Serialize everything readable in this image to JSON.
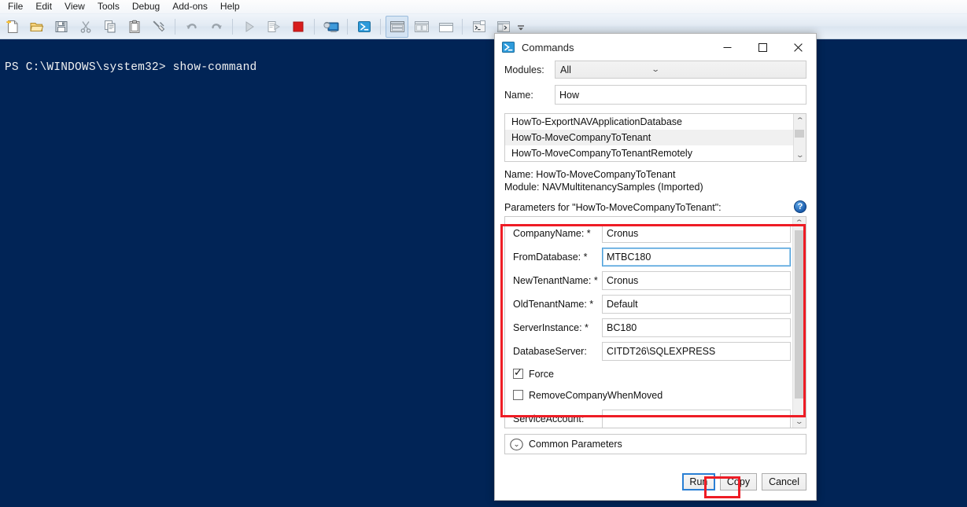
{
  "app": {
    "menu": [
      "File",
      "Edit",
      "View",
      "Tools",
      "Debug",
      "Add-ons",
      "Help"
    ],
    "toolbar_icons": [
      "new-script-icon",
      "open-folder-icon",
      "save-icon",
      "cut-icon",
      "copy-icon",
      "paste-icon",
      "clear-console-icon",
      "undo-icon",
      "redo-icon",
      "run-script-icon",
      "run-selection-icon",
      "stop-icon",
      "new-remote-tab-icon",
      "start-powershell-icon",
      "layout-horizontal-icon",
      "layout-vertical-icon",
      "layout-maximized-icon",
      "show-script-pane-icon",
      "show-console-pane-icon"
    ],
    "toolbar_overflow": "toolbar-overflow-icon"
  },
  "console": {
    "prompt_line": "PS C:\\WINDOWS\\system32> show-command",
    "background": "#012456",
    "foreground": "#f2f2f2"
  },
  "dialog": {
    "title": "Commands",
    "icon": "powershell-icon",
    "window_buttons": {
      "minimize": "—",
      "maximize": "☐",
      "close": "✕"
    },
    "modules": {
      "label": "Modules:",
      "value": "All"
    },
    "name": {
      "label": "Name:",
      "value": "How",
      "placeholder": ""
    },
    "command_list": [
      {
        "text": "HowTo-ExportNAVApplicationDatabase",
        "selected": false
      },
      {
        "text": "HowTo-MoveCompanyToTenant",
        "selected": true
      },
      {
        "text": "HowTo-MoveCompanyToTenantRemotely",
        "selected": false
      }
    ],
    "meta": {
      "name_line": "Name: HowTo-MoveCompanyToTenant",
      "module_line": "Module: NAVMultitenancySamples (Imported)"
    },
    "parameters_header": "Parameters for \"HowTo-MoveCompanyToTenant\":",
    "help_glyph": "?",
    "parameters": [
      {
        "label": "CompanyName: *",
        "value": "Cronus",
        "type": "text",
        "focused": false
      },
      {
        "label": "FromDatabase: *",
        "value": "MTBC180",
        "type": "text",
        "focused": true
      },
      {
        "label": "NewTenantName: *",
        "value": "Cronus",
        "type": "text",
        "focused": false
      },
      {
        "label": "OldTenantName: *",
        "value": "Default",
        "type": "text",
        "focused": false
      },
      {
        "label": "ServerInstance: *",
        "value": "BC180",
        "type": "text",
        "focused": false
      },
      {
        "label": "DatabaseServer:",
        "value": "CITDT26\\SQLEXPRESS",
        "type": "text",
        "focused": false
      },
      {
        "label": "Force",
        "value": "",
        "type": "checkbox",
        "checked": true
      },
      {
        "label": "RemoveCompanyWhenMoved",
        "value": "",
        "type": "checkbox",
        "checked": false
      },
      {
        "label": "ServiceAccount:",
        "value": "",
        "type": "text",
        "focused": false
      }
    ],
    "common_parameters": {
      "label": "Common Parameters",
      "expander_icon": "chevron-down-circle-icon"
    },
    "footer_buttons": [
      {
        "label": "Run",
        "primary": true,
        "annotated": true
      },
      {
        "label": "Copy",
        "primary": false,
        "annotated": false
      },
      {
        "label": "Cancel",
        "primary": false,
        "annotated": false
      }
    ]
  },
  "annotations": {
    "color": "#ee1c25",
    "boxes": [
      "parameters-panel-highlight",
      "run-button-highlight"
    ]
  }
}
